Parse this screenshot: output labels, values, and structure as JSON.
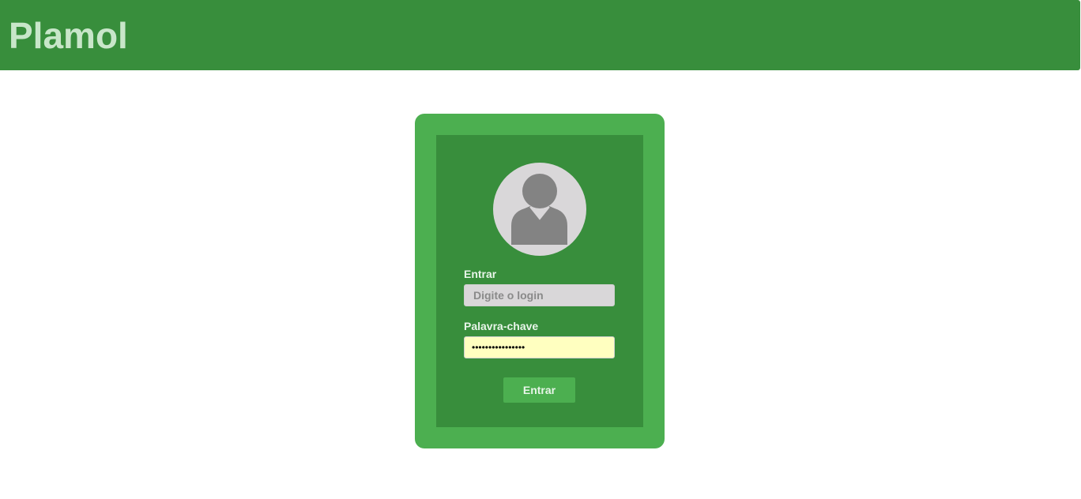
{
  "header": {
    "brand": "Plamol",
    "background_color": "#388e3c",
    "brand_color": "#c8e6c9"
  },
  "login_card": {
    "avatar_icon": "user-avatar-icon",
    "login_label": "Entrar",
    "login_placeholder": "Digite o login",
    "login_value": "",
    "password_label": "Palavra-chave",
    "password_value": "••••••••••••••••",
    "submit_label": "Entrar",
    "outer_color": "#4caf50",
    "inner_color": "#388e3c"
  }
}
